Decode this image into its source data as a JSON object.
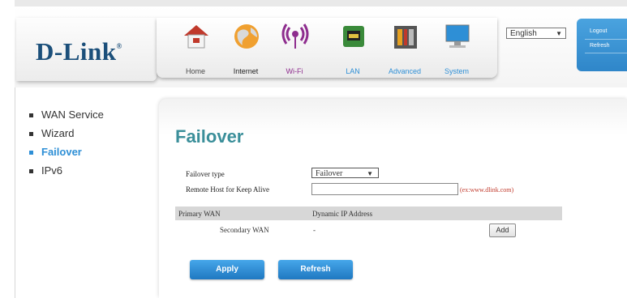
{
  "brand": {
    "logo": "D-Link",
    "registered_mark": "®"
  },
  "nav": {
    "items": [
      {
        "label": "Home",
        "icon": "home-icon"
      },
      {
        "label": "Internet",
        "icon": "globe-icon"
      },
      {
        "label": "Wi-Fi",
        "icon": "wifi-icon"
      },
      {
        "label": "LAN",
        "icon": "lan-icon"
      },
      {
        "label": "Advanced",
        "icon": "tools-icon"
      },
      {
        "label": "System",
        "icon": "monitor-icon"
      }
    ]
  },
  "language": {
    "selected": "English"
  },
  "side_panel": {
    "logout": "Logout",
    "refresh": "Refresh"
  },
  "left_menu": {
    "items": [
      {
        "label": "WAN Service",
        "active": false
      },
      {
        "label": "Wizard",
        "active": false
      },
      {
        "label": "Failover",
        "active": true
      },
      {
        "label": "IPv6",
        "active": false
      }
    ]
  },
  "page": {
    "title": "Failover"
  },
  "form": {
    "failover_type_label": "Failover type",
    "failover_type_value": "Failover",
    "remote_host_label": "Remote Host for Keep Alive",
    "remote_host_value": "",
    "remote_host_hint": "(ex:www.dlink.com)"
  },
  "table": {
    "header": [
      "Primary WAN",
      "Dynamic IP Address"
    ],
    "row": {
      "label": "Secondary WAN",
      "value": "-",
      "add_label": "Add"
    }
  },
  "buttons": {
    "apply": "Apply",
    "refresh": "Refresh"
  },
  "colors": {
    "accent_blue": "#2e8fd6",
    "title_teal": "#3b8f9a",
    "hint_red": "#c0392b"
  }
}
